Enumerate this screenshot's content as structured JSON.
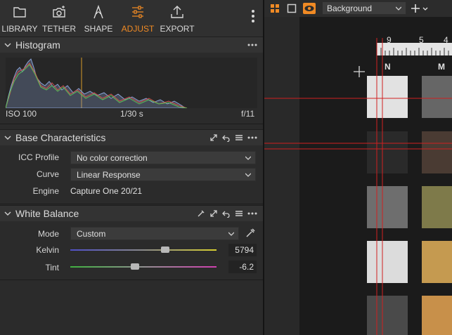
{
  "toolbar": {
    "tabs": [
      {
        "label": "LIBRARY",
        "icon": "folder-icon"
      },
      {
        "label": "TETHER",
        "icon": "camera-icon"
      },
      {
        "label": "SHAPE",
        "icon": "shape-icon"
      },
      {
        "label": "ADJUST",
        "icon": "sliders-icon",
        "active": true
      },
      {
        "label": "EXPORT",
        "icon": "export-icon"
      }
    ],
    "accent": "#f08a24"
  },
  "histogram": {
    "title": "Histogram",
    "iso": "ISO 100",
    "shutter": "1/30 s",
    "aperture": "f/11"
  },
  "base": {
    "title": "Base Characteristics",
    "icc_label": "ICC Profile",
    "icc_value": "No color correction",
    "curve_label": "Curve",
    "curve_value": "Linear Response",
    "engine_label": "Engine",
    "engine_value": "Capture One 20/21"
  },
  "wb": {
    "title": "White Balance",
    "mode_label": "Mode",
    "mode_value": "Custom",
    "kelvin_label": "Kelvin",
    "kelvin_value": "5794",
    "kelvin_level": 0.65,
    "tint_label": "Tint",
    "tint_value": "-6.2",
    "tint_level": 0.44
  },
  "viewer": {
    "background_label": "Background",
    "ruler_labels": [
      "9",
      "5",
      "4"
    ],
    "patch_labels": [
      "N",
      "M"
    ]
  }
}
